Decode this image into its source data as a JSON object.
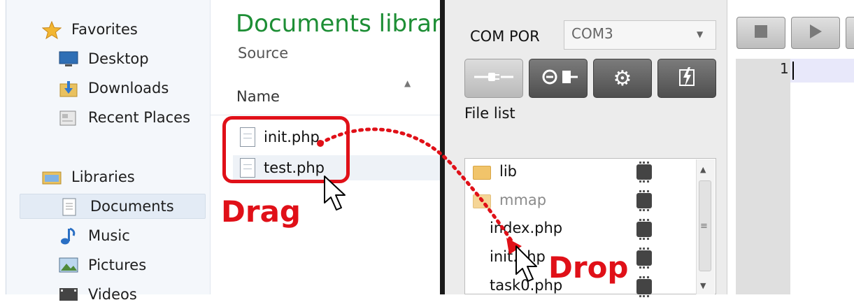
{
  "explorer": {
    "sidebar": {
      "favorites": "Favorites",
      "desktop": "Desktop",
      "downloads": "Downloads",
      "recent_places": "Recent Places",
      "libraries": "Libraries",
      "documents": "Documents",
      "music": "Music",
      "pictures": "Pictures",
      "videos": "Videos"
    },
    "library_title": "Documents librar",
    "library_subtitle": "Source",
    "column_name": "Name",
    "files": [
      "init.php",
      "test.php"
    ]
  },
  "annotations": {
    "drag": "Drag",
    "drop": "Drop",
    "color": "#e01018"
  },
  "tool": {
    "com_label": "COM POR",
    "com_value": "COM3",
    "buttons": [
      "plug-icon",
      "connect-icon",
      "gear-icon",
      "flash-chip-icon"
    ],
    "file_list_label": "File list",
    "file_list": [
      {
        "name": "lib",
        "type": "folder"
      },
      {
        "name": "mmap",
        "type": "folder"
      },
      {
        "name": "index.php",
        "type": "file"
      },
      {
        "name": "init.php",
        "type": "file"
      },
      {
        "name": "task0.php",
        "type": "file"
      }
    ]
  },
  "editor": {
    "line_number": "1",
    "buttons": [
      "stop-icon",
      "play-icon"
    ]
  }
}
